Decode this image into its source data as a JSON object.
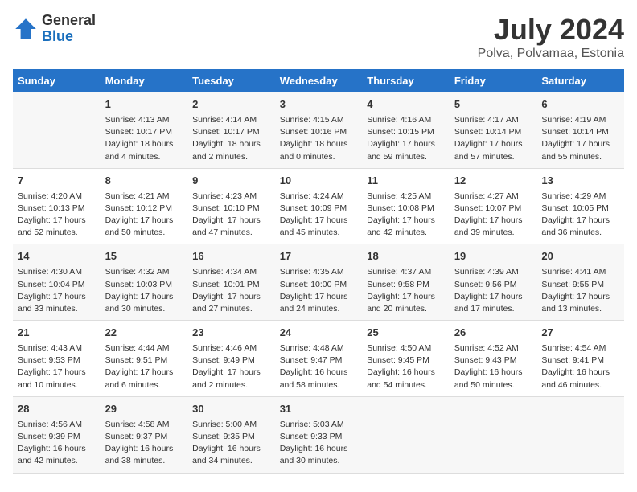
{
  "header": {
    "logo_general": "General",
    "logo_blue": "Blue",
    "title": "July 2024",
    "subtitle": "Polva, Polvamaa, Estonia"
  },
  "columns": [
    "Sunday",
    "Monday",
    "Tuesday",
    "Wednesday",
    "Thursday",
    "Friday",
    "Saturday"
  ],
  "weeks": [
    [
      {
        "day": "",
        "sunrise": "",
        "sunset": "",
        "daylight": ""
      },
      {
        "day": "1",
        "sunrise": "Sunrise: 4:13 AM",
        "sunset": "Sunset: 10:17 PM",
        "daylight": "Daylight: 18 hours and 4 minutes."
      },
      {
        "day": "2",
        "sunrise": "Sunrise: 4:14 AM",
        "sunset": "Sunset: 10:17 PM",
        "daylight": "Daylight: 18 hours and 2 minutes."
      },
      {
        "day": "3",
        "sunrise": "Sunrise: 4:15 AM",
        "sunset": "Sunset: 10:16 PM",
        "daylight": "Daylight: 18 hours and 0 minutes."
      },
      {
        "day": "4",
        "sunrise": "Sunrise: 4:16 AM",
        "sunset": "Sunset: 10:15 PM",
        "daylight": "Daylight: 17 hours and 59 minutes."
      },
      {
        "day": "5",
        "sunrise": "Sunrise: 4:17 AM",
        "sunset": "Sunset: 10:14 PM",
        "daylight": "Daylight: 17 hours and 57 minutes."
      },
      {
        "day": "6",
        "sunrise": "Sunrise: 4:19 AM",
        "sunset": "Sunset: 10:14 PM",
        "daylight": "Daylight: 17 hours and 55 minutes."
      }
    ],
    [
      {
        "day": "7",
        "sunrise": "Sunrise: 4:20 AM",
        "sunset": "Sunset: 10:13 PM",
        "daylight": "Daylight: 17 hours and 52 minutes."
      },
      {
        "day": "8",
        "sunrise": "Sunrise: 4:21 AM",
        "sunset": "Sunset: 10:12 PM",
        "daylight": "Daylight: 17 hours and 50 minutes."
      },
      {
        "day": "9",
        "sunrise": "Sunrise: 4:23 AM",
        "sunset": "Sunset: 10:10 PM",
        "daylight": "Daylight: 17 hours and 47 minutes."
      },
      {
        "day": "10",
        "sunrise": "Sunrise: 4:24 AM",
        "sunset": "Sunset: 10:09 PM",
        "daylight": "Daylight: 17 hours and 45 minutes."
      },
      {
        "day": "11",
        "sunrise": "Sunrise: 4:25 AM",
        "sunset": "Sunset: 10:08 PM",
        "daylight": "Daylight: 17 hours and 42 minutes."
      },
      {
        "day": "12",
        "sunrise": "Sunrise: 4:27 AM",
        "sunset": "Sunset: 10:07 PM",
        "daylight": "Daylight: 17 hours and 39 minutes."
      },
      {
        "day": "13",
        "sunrise": "Sunrise: 4:29 AM",
        "sunset": "Sunset: 10:05 PM",
        "daylight": "Daylight: 17 hours and 36 minutes."
      }
    ],
    [
      {
        "day": "14",
        "sunrise": "Sunrise: 4:30 AM",
        "sunset": "Sunset: 10:04 PM",
        "daylight": "Daylight: 17 hours and 33 minutes."
      },
      {
        "day": "15",
        "sunrise": "Sunrise: 4:32 AM",
        "sunset": "Sunset: 10:03 PM",
        "daylight": "Daylight: 17 hours and 30 minutes."
      },
      {
        "day": "16",
        "sunrise": "Sunrise: 4:34 AM",
        "sunset": "Sunset: 10:01 PM",
        "daylight": "Daylight: 17 hours and 27 minutes."
      },
      {
        "day": "17",
        "sunrise": "Sunrise: 4:35 AM",
        "sunset": "Sunset: 10:00 PM",
        "daylight": "Daylight: 17 hours and 24 minutes."
      },
      {
        "day": "18",
        "sunrise": "Sunrise: 4:37 AM",
        "sunset": "Sunset: 9:58 PM",
        "daylight": "Daylight: 17 hours and 20 minutes."
      },
      {
        "day": "19",
        "sunrise": "Sunrise: 4:39 AM",
        "sunset": "Sunset: 9:56 PM",
        "daylight": "Daylight: 17 hours and 17 minutes."
      },
      {
        "day": "20",
        "sunrise": "Sunrise: 4:41 AM",
        "sunset": "Sunset: 9:55 PM",
        "daylight": "Daylight: 17 hours and 13 minutes."
      }
    ],
    [
      {
        "day": "21",
        "sunrise": "Sunrise: 4:43 AM",
        "sunset": "Sunset: 9:53 PM",
        "daylight": "Daylight: 17 hours and 10 minutes."
      },
      {
        "day": "22",
        "sunrise": "Sunrise: 4:44 AM",
        "sunset": "Sunset: 9:51 PM",
        "daylight": "Daylight: 17 hours and 6 minutes."
      },
      {
        "day": "23",
        "sunrise": "Sunrise: 4:46 AM",
        "sunset": "Sunset: 9:49 PM",
        "daylight": "Daylight: 17 hours and 2 minutes."
      },
      {
        "day": "24",
        "sunrise": "Sunrise: 4:48 AM",
        "sunset": "Sunset: 9:47 PM",
        "daylight": "Daylight: 16 hours and 58 minutes."
      },
      {
        "day": "25",
        "sunrise": "Sunrise: 4:50 AM",
        "sunset": "Sunset: 9:45 PM",
        "daylight": "Daylight: 16 hours and 54 minutes."
      },
      {
        "day": "26",
        "sunrise": "Sunrise: 4:52 AM",
        "sunset": "Sunset: 9:43 PM",
        "daylight": "Daylight: 16 hours and 50 minutes."
      },
      {
        "day": "27",
        "sunrise": "Sunrise: 4:54 AM",
        "sunset": "Sunset: 9:41 PM",
        "daylight": "Daylight: 16 hours and 46 minutes."
      }
    ],
    [
      {
        "day": "28",
        "sunrise": "Sunrise: 4:56 AM",
        "sunset": "Sunset: 9:39 PM",
        "daylight": "Daylight: 16 hours and 42 minutes."
      },
      {
        "day": "29",
        "sunrise": "Sunrise: 4:58 AM",
        "sunset": "Sunset: 9:37 PM",
        "daylight": "Daylight: 16 hours and 38 minutes."
      },
      {
        "day": "30",
        "sunrise": "Sunrise: 5:00 AM",
        "sunset": "Sunset: 9:35 PM",
        "daylight": "Daylight: 16 hours and 34 minutes."
      },
      {
        "day": "31",
        "sunrise": "Sunrise: 5:03 AM",
        "sunset": "Sunset: 9:33 PM",
        "daylight": "Daylight: 16 hours and 30 minutes."
      },
      {
        "day": "",
        "sunrise": "",
        "sunset": "",
        "daylight": ""
      },
      {
        "day": "",
        "sunrise": "",
        "sunset": "",
        "daylight": ""
      },
      {
        "day": "",
        "sunrise": "",
        "sunset": "",
        "daylight": ""
      }
    ]
  ]
}
